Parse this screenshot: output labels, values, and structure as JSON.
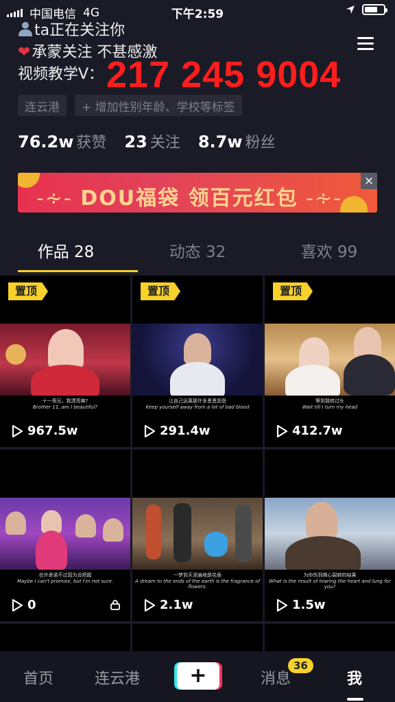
{
  "status": {
    "carrier": "中国电信",
    "network": "4G",
    "time": "下午2:59",
    "battery_level": 0.7
  },
  "bio": {
    "line1": "ta正在关注你",
    "line2": "承蒙关注 不甚感激",
    "line3_label": "视频教学V：",
    "phone_overlay": "217 245 9004"
  },
  "tags": [
    "连云港",
    "+ 增加性别年龄、学校等标签"
  ],
  "stats": [
    {
      "value": "76.2w",
      "label": "获赞"
    },
    {
      "value": "23",
      "label": "关注"
    },
    {
      "value": "8.7w",
      "label": "粉丝"
    }
  ],
  "banner": {
    "text": "DOU福袋  领百元红包",
    "close": "×"
  },
  "tabs": [
    {
      "label": "作品 28",
      "active": true
    },
    {
      "label": "动态 32",
      "active": false
    },
    {
      "label": "喜欢 99",
      "active": false
    }
  ],
  "videos": [
    {
      "pinned": true,
      "pin_label": "置顶",
      "views": "967.5w",
      "sub_cn": "十一哥兄，我漂亮嘛?",
      "sub_en": "Brother 11, am I beautiful?",
      "locked": false
    },
    {
      "pinned": true,
      "pin_label": "置顶",
      "views": "291.4w",
      "sub_cn": "让自己远离那许多恩恩怨怨",
      "sub_en": "Keep yourself away from a lot of bad blood",
      "locked": false
    },
    {
      "pinned": true,
      "pin_label": "置顶",
      "views": "412.7w",
      "sub_cn": "等到我转过头",
      "sub_en": "Wait till I turn my head",
      "locked": false
    },
    {
      "pinned": false,
      "pin_label": "",
      "views": "0",
      "sub_cn": "也许承诺不过因为没把握",
      "sub_en": "Maybe I can't promise, but I'm not sure.",
      "locked": true
    },
    {
      "pinned": false,
      "pin_label": "",
      "views": "2.1w",
      "sub_cn": "一梦到天涯遍地是花香",
      "sub_en": "A dream to the ends of the earth is the fragrance of flowers.",
      "locked": false
    },
    {
      "pinned": false,
      "pin_label": "",
      "views": "1.5w",
      "sub_cn": "为你伤到撕心裂肺的结果",
      "sub_en": "What is the result of tearing the heart and lung for you?",
      "locked": false
    }
  ],
  "nav": {
    "home": "首页",
    "city": "连云港",
    "plus": "+",
    "messages": "消息",
    "messages_badge": "36",
    "me": "我"
  }
}
